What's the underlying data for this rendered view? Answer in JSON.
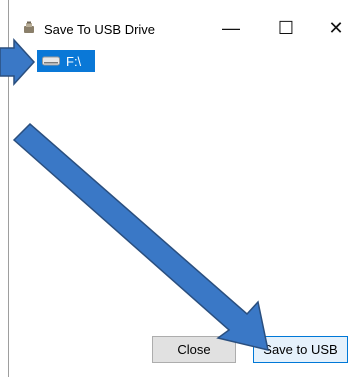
{
  "window": {
    "title": "Save To USB Drive",
    "icon": "usb-drive-icon",
    "controls": {
      "minimize": "—",
      "maximize": "☐",
      "close": "✕"
    }
  },
  "tree": {
    "items": [
      {
        "label": "F:\\",
        "icon": "drive-icon",
        "selected": true
      }
    ]
  },
  "buttons": {
    "close_label": "Close",
    "save_label": "Save to USB"
  },
  "colors": {
    "selection": "#0a78d7",
    "annotation_arrow": "#3a78c6",
    "annotation_arrow_outline": "#2a4f7f"
  }
}
